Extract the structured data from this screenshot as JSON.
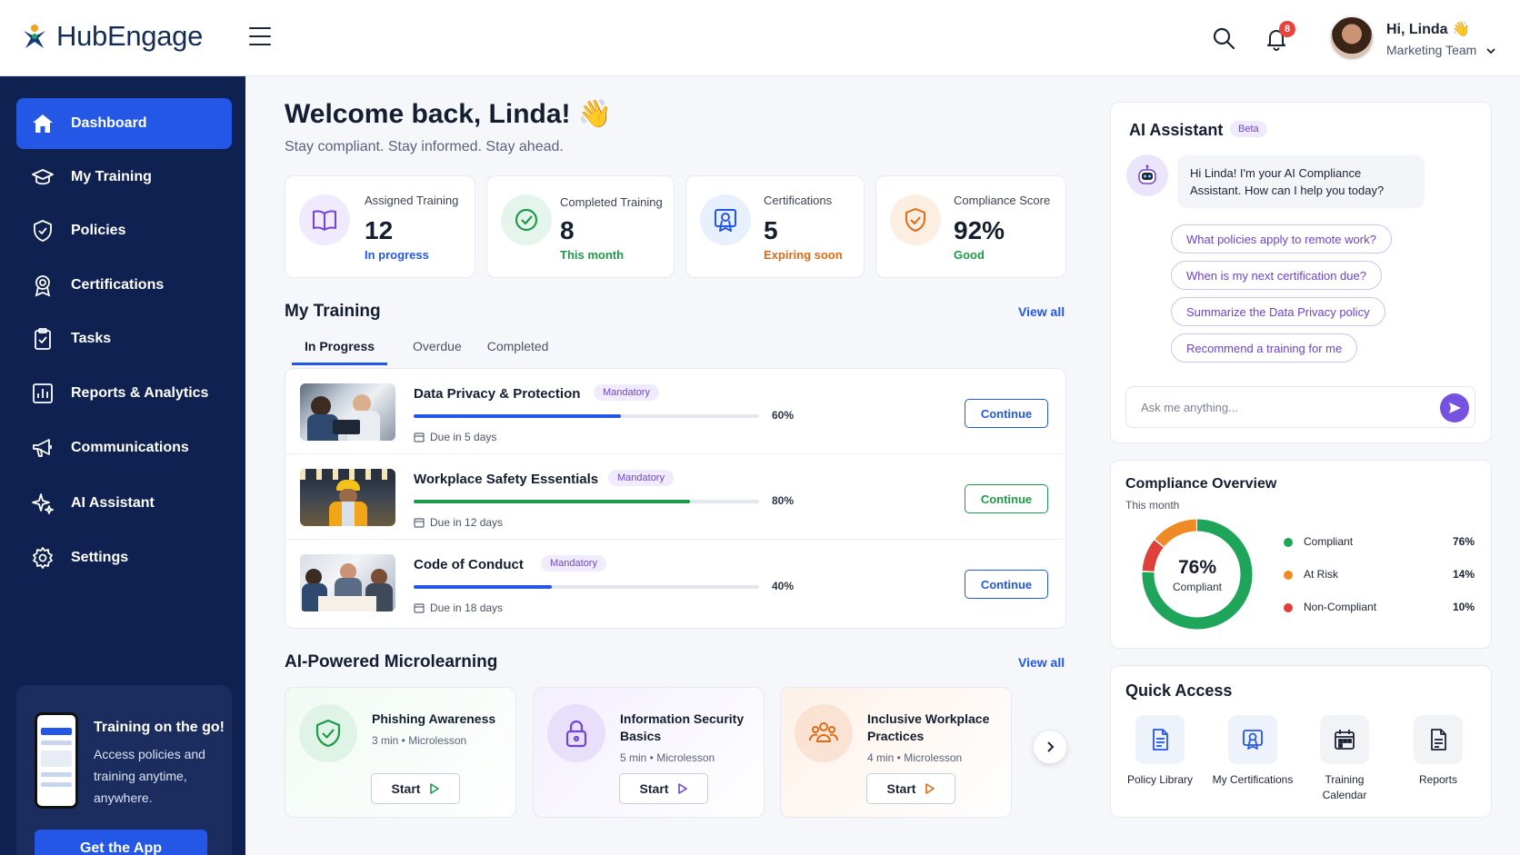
{
  "app": {
    "name": "HubEngage"
  },
  "header": {
    "greeting": "Hi, Linda 👋",
    "team": "Marketing Team",
    "notification_count": "8"
  },
  "sidebar": {
    "items": [
      {
        "label": "Dashboard",
        "icon": "home-icon",
        "active": true
      },
      {
        "label": "My Training",
        "icon": "graduation-cap-icon"
      },
      {
        "label": "Policies",
        "icon": "shield-icon"
      },
      {
        "label": "Certifications",
        "icon": "badge-icon"
      },
      {
        "label": "Tasks",
        "icon": "clipboard-icon"
      },
      {
        "label": "Reports & Analytics",
        "icon": "bar-chart-icon"
      },
      {
        "label": "Communications",
        "icon": "megaphone-icon"
      },
      {
        "label": "AI Assistant",
        "icon": "sparkles-icon"
      },
      {
        "label": "Settings",
        "icon": "gear-icon"
      }
    ],
    "promo": {
      "title": "Training on the go!",
      "text": "Access policies and training anytime, anywhere.",
      "button": "Get the App"
    }
  },
  "welcome": {
    "title": "Welcome back, Linda! 👋",
    "subtitle": "Stay compliant. Stay informed. Stay ahead."
  },
  "stats": [
    {
      "label": "Assigned Training",
      "value": "12",
      "sub": "In progress",
      "sub_color": "#2457e6",
      "icon": "book-icon"
    },
    {
      "label": "Completed Training",
      "value": "8",
      "sub": "This month",
      "sub_color": "#1f9a4a",
      "icon": "check-circle-icon"
    },
    {
      "label": "Certifications",
      "value": "5",
      "sub": "Expiring soon",
      "sub_color": "#e06a16",
      "icon": "certificate-icon"
    },
    {
      "label": "Compliance Score",
      "value": "92%",
      "sub": "Good",
      "sub_color": "#1f9a4a",
      "icon": "shield-check-icon"
    }
  ],
  "my_training": {
    "title": "My Training",
    "view_all": "View all",
    "tabs": [
      "In Progress",
      "Overdue",
      "Completed"
    ],
    "rows": [
      {
        "name": "Data Privacy & Protection",
        "tag": "Mandatory",
        "progress": 60,
        "progress_label": "60%",
        "due": "Due in 5 days",
        "action": "Continue",
        "bar_color": "#2457e6"
      },
      {
        "name": "Workplace Safety Essentials",
        "tag": "Mandatory",
        "progress": 80,
        "progress_label": "80%",
        "due": "Due in 12 days",
        "action": "Continue",
        "bar_color": "#1f9a4a"
      },
      {
        "name": "Code of Conduct",
        "tag": "Mandatory",
        "progress": 40,
        "progress_label": "40%",
        "due": "Due in 18 days",
        "action": "Continue",
        "bar_color": "#2457e6"
      }
    ]
  },
  "microlearning": {
    "title": "AI-Powered Microlearning",
    "view_all": "View all",
    "cards": [
      {
        "title": "Phishing Awareness",
        "meta": "3 min • Microlesson",
        "action": "Start",
        "icon": "shield-check-icon"
      },
      {
        "title": "Information Security Basics",
        "meta": "5 min • Microlesson",
        "action": "Start",
        "icon": "lock-icon"
      },
      {
        "title": "Inclusive Workplace Practices",
        "meta": "4 min • Microlesson",
        "action": "Start",
        "icon": "people-icon"
      }
    ]
  },
  "ai_assistant": {
    "title": "AI Assistant",
    "badge": "Beta",
    "message": "Hi Linda! I'm your AI Compliance Assistant. How can I help you today?",
    "suggestions": [
      "What policies apply to remote work?",
      "When is my next certification due?",
      "Summarize the Data Privacy policy",
      "Recommend a training for me"
    ],
    "input_placeholder": "Ask me anything..."
  },
  "compliance_overview": {
    "title": "Compliance Overview",
    "period": "This month",
    "center_value": "76%",
    "center_label": "Compliant",
    "segments": [
      {
        "name": "Compliant",
        "value": 76,
        "label": "76%",
        "color": "#1fa55a"
      },
      {
        "name": "At Risk",
        "value": 14,
        "label": "14%",
        "color": "#f08a24"
      },
      {
        "name": "Non-Compliant",
        "value": 10,
        "label": "10%",
        "color": "#e0403a"
      }
    ]
  },
  "quick_access": {
    "title": "Quick Access",
    "items": [
      {
        "label": "Policy Library",
        "icon": "document-icon"
      },
      {
        "label": "My Certifications",
        "icon": "certificate-icon"
      },
      {
        "label": "Training Calendar",
        "icon": "calendar-icon"
      },
      {
        "label": "Reports",
        "icon": "report-icon"
      }
    ]
  }
}
